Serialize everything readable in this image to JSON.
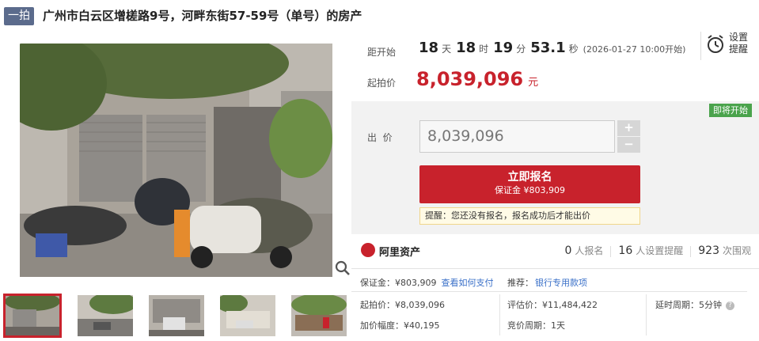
{
  "header": {
    "badge": "一拍",
    "title": "广州市白云区增槎路9号，河畔东街57-59号（单号）的房产"
  },
  "gallery": {
    "thumbnail_count": 5,
    "active_index": 0
  },
  "countdown": {
    "label": "距开始",
    "days": "18",
    "days_unit": "天",
    "hours": "18",
    "hours_unit": "时",
    "minutes": "19",
    "minutes_unit": "分",
    "seconds": "53.1",
    "seconds_unit": "秒",
    "start_note": "(2026-01-27 10:00开始)"
  },
  "reminder": {
    "label_line1": "设置",
    "label_line2": "提醒"
  },
  "start_price": {
    "label": "起拍价",
    "value": "8,039,096",
    "unit": "元"
  },
  "bid": {
    "status_badge": "即将开始",
    "label": "出  价",
    "input_value": "8,039,096",
    "plus": "+",
    "minus": "−",
    "signup_main": "立即报名",
    "signup_sub": "保证金 ¥803,909",
    "tip": "提醒：您还没有报名，报名成功后才能出价"
  },
  "platform": {
    "name": "阿里资产",
    "signups": "0",
    "signups_label": "人报名",
    "reminders": "16",
    "reminders_label": "人设置提醒",
    "views": "923",
    "views_label": "次围观"
  },
  "details": {
    "deposit": "保证金：¥803,909",
    "deposit_link": "查看如何支付",
    "recommend": "推荐：",
    "recommend_link": "银行专用款项",
    "start_price": "起拍价：¥8,039,096",
    "appraisal": "评估价：¥11,484,422",
    "delay": "延时周期：5分钟",
    "increment": "加价幅度：¥40,195",
    "bidding_period": "竞价周期：1天"
  },
  "colors": {
    "accent": "#c8222c",
    "badge": "#5b6b8c",
    "status_green": "#4aa34c",
    "link": "#3a70c8"
  }
}
